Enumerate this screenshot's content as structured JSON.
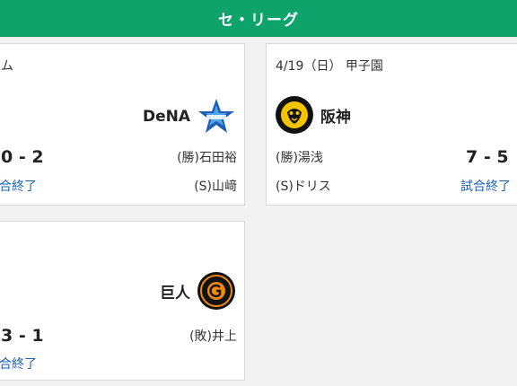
{
  "league": {
    "title": "セ・リーグ"
  },
  "games": [
    {
      "meta": "ム",
      "team": "DeNA",
      "score": "0 - 2",
      "pitcher_win": "(勝)石田裕",
      "pitcher_save": "(S)山﨑",
      "status": "試合終了",
      "status_visible": "試合終了",
      "logo_icon": "baystars-star-icon"
    },
    {
      "meta": "4/19（日） 甲子園",
      "team": "阪神",
      "score": "7 - 5",
      "pitcher_win": "(勝)湯浅",
      "pitcher_save": "(S)ドリス",
      "status": "試合終了",
      "logo_icon": "tigers-logo-icon"
    },
    {
      "team": "巨人",
      "score": "3 - 1",
      "pitcher_loss": "(敗)井上",
      "status": "試合終了",
      "logo_icon": "giants-logo-icon"
    }
  ],
  "colors": {
    "league_bar": "#0fa36c",
    "link": "#1b5fb8",
    "baystars_blue": "#1c5fb5",
    "tigers_gold": "#f5c400",
    "giants_orange": "#f08a0a"
  }
}
